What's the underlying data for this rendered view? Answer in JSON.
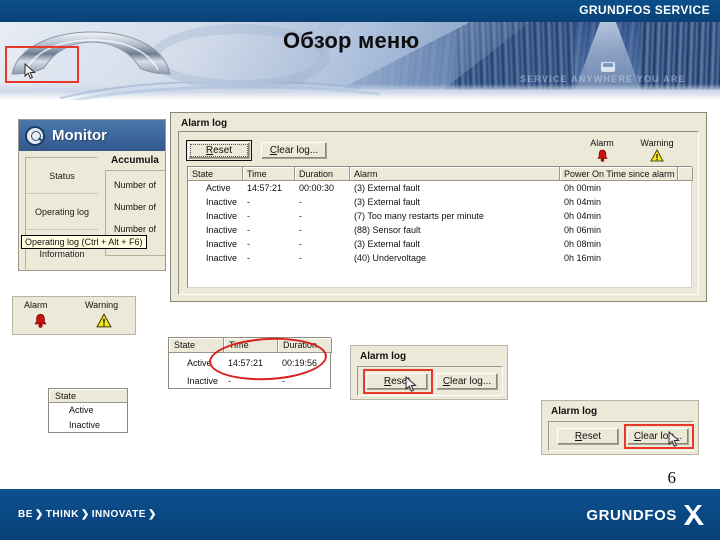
{
  "header": {
    "brand": "GRUNDFOS SERVICE",
    "title": "Обзор меню",
    "tagline": "SERVICE ANYWHERE YOU ARE"
  },
  "monitor": {
    "title": "Monitor",
    "icon": "magnifier-icon",
    "tabs": [
      {
        "label": "Status"
      },
      {
        "label": "Operating log"
      },
      {
        "label": "Information"
      }
    ],
    "tooltip": "Operating log (Ctrl + Alt + F6)",
    "accumulated": {
      "heading": "Accumula",
      "rows": [
        "Number of",
        "Number of",
        "Number of"
      ]
    }
  },
  "alarm_log": {
    "title": "Alarm log",
    "buttons": {
      "reset": "Reset",
      "reset_accel": "R",
      "clear": "Clear log...",
      "clear_accel": "C"
    },
    "legend": {
      "alarm_label": "Alarm",
      "warning_label": "Warning"
    },
    "columns": [
      "State",
      "Time",
      "Duration",
      "Alarm",
      "Power On Time since alarm",
      ""
    ],
    "rows": [
      {
        "state": "Active",
        "icon": "bell-red-icon",
        "time": "14:57:21",
        "duration": "00:00:30",
        "alarm": "(3) External fault",
        "power_on": "0h 00min"
      },
      {
        "state": "Inactive",
        "icon": "bell-gray-icon",
        "time": "-",
        "duration": "-",
        "alarm": "(3) External fault",
        "power_on": "0h 04min"
      },
      {
        "state": "Inactive",
        "icon": "bell-gray-icon",
        "time": "-",
        "duration": "-",
        "alarm": "(7) Too many restarts per minute",
        "power_on": "0h 04min"
      },
      {
        "state": "Inactive",
        "icon": "bell-gray-icon",
        "time": "-",
        "duration": "-",
        "alarm": "(88) Sensor fault",
        "power_on": "0h 06min"
      },
      {
        "state": "Inactive",
        "icon": "bell-gray-icon",
        "time": "-",
        "duration": "-",
        "alarm": "(3) External fault",
        "power_on": "0h 08min"
      },
      {
        "state": "Inactive",
        "icon": "bell-gray-icon",
        "time": "-",
        "duration": "-",
        "alarm": "(40) Undervoltage",
        "power_on": "0h 16min"
      }
    ]
  },
  "callout_legend": {
    "alarm_label": "Alarm",
    "warning_label": "Warning"
  },
  "callout_mini_table": {
    "columns": [
      "State",
      "Time",
      "Duration"
    ],
    "rows": [
      {
        "state": "Active",
        "time": "14:57:21",
        "duration": "00:19:56"
      },
      {
        "state": "Inactive",
        "time": "-",
        "duration": "-"
      }
    ]
  },
  "callout_state": {
    "header": "State",
    "rows": [
      "Active",
      "Inactive"
    ]
  },
  "callout_reset": {
    "title": "Alarm log",
    "reset": "Reset",
    "reset_accel": "R",
    "clear": "Clear log...",
    "clear_accel": "C"
  },
  "callout_clear": {
    "title": "Alarm log",
    "reset": "Reset",
    "reset_accel": "R",
    "clear": "Clear log...",
    "clear_accel": "C"
  },
  "footer": {
    "slogan_parts": [
      "BE",
      "THINK",
      "INNOVATE"
    ],
    "chevron": "❯",
    "logo_word": "GRUNDFOS",
    "logo_mark": "grundfos-x-icon",
    "page_number": "6"
  },
  "colors": {
    "brand_blue": "#0a4b84",
    "accent_red": "#e8372b",
    "alarm_red": "#cc1111",
    "warning_yellow": "#f2e400",
    "win_face": "#ece9d8"
  }
}
